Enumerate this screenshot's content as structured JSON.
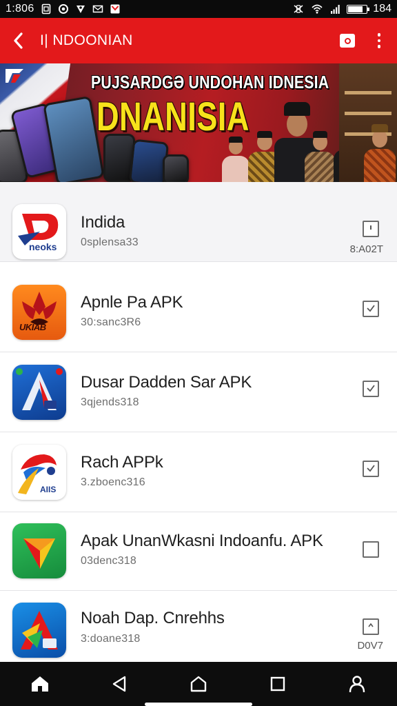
{
  "status_bar": {
    "time": "1:806",
    "battery_text": "184",
    "battery_level": 0.75,
    "icons": [
      "sim-icon",
      "alarm-icon",
      "location-icon",
      "mail-icon",
      "media-icon",
      "vibrate-icon",
      "wifi-icon",
      "signal-icon",
      "battery-icon"
    ]
  },
  "app_bar": {
    "title": "I| NDOONIAN",
    "icons": [
      "back-arrow-icon",
      "camera-icon",
      "more-vert-icon"
    ]
  },
  "banner": {
    "line1": "PUJSARDGƏ UNDOHAN IDNESIA",
    "line2": "DNANISIA"
  },
  "colors": {
    "accent": "#e3191b",
    "banner_yellow": "#f7e21b",
    "text_primary": "#1f1f1f",
    "text_secondary": "#6d6d6d",
    "nav_bg": "#0d0d0d"
  },
  "apps": [
    {
      "name": "Indida",
      "subtitle": "0splensa33",
      "action_icon": "download-icon",
      "side_note": "8:A02T"
    },
    {
      "name": "Apnle Pa APK",
      "subtitle": "30:sanc3R6",
      "action_icon": "check-icon",
      "side_note": ""
    },
    {
      "name": "Dusar Dadden Sar APK",
      "subtitle": "3qjends318",
      "action_icon": "check-icon",
      "side_note": ""
    },
    {
      "name": "Rach APPk",
      "subtitle": "3.zboenc316",
      "action_icon": "check-icon",
      "side_note": ""
    },
    {
      "name": "Apak UnanWkasni Indoanfu. APK",
      "subtitle": "03denc318",
      "action_icon": "empty-checkbox-icon",
      "side_note": ""
    },
    {
      "name": "Noah Dap. Cnrehhs",
      "subtitle": "3:doane318",
      "action_icon": "info-icon",
      "side_note": "D0V7"
    }
  ],
  "app_icon_text": {
    "icon1": "neoks",
    "icon2": "UKIAB",
    "icon4": "AIIS"
  },
  "nav_bar": {
    "buttons": [
      "home-icon",
      "back-triangle-icon",
      "home-circle-icon",
      "recents-square-icon",
      "profile-icon"
    ]
  }
}
